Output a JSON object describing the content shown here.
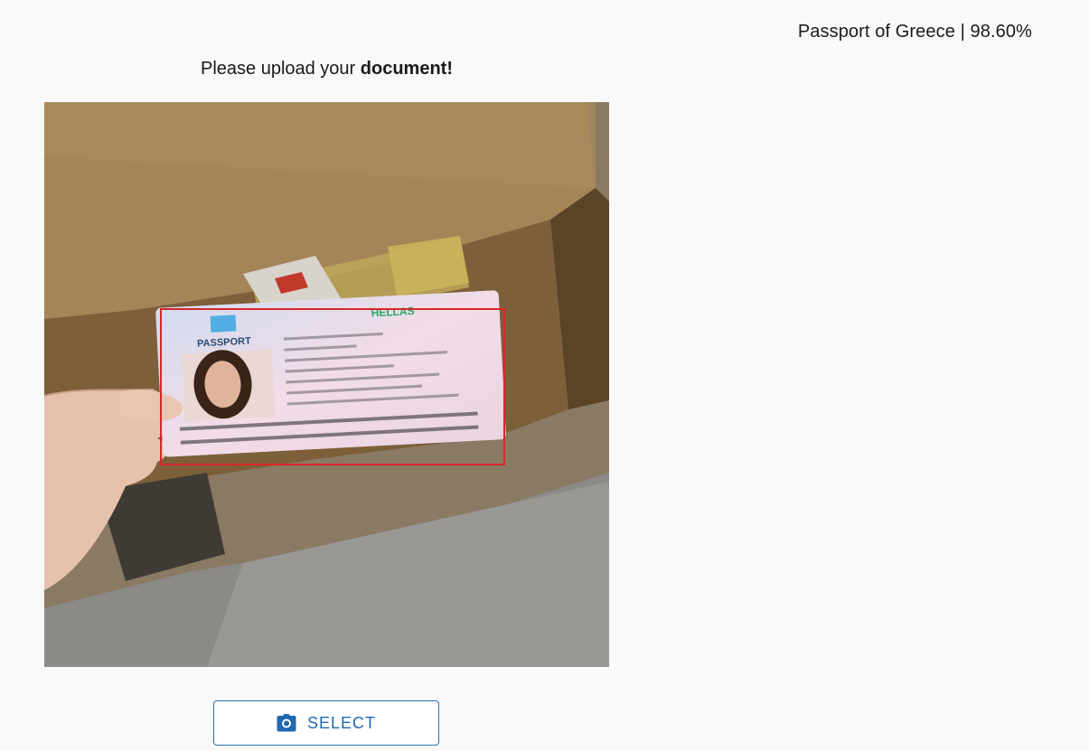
{
  "result": {
    "text": "Passport of Greece | 98.60%"
  },
  "prompt": {
    "lead": "Please upload your ",
    "emphasis": "document!"
  },
  "photo": {
    "passport_label": "PASSPORT",
    "country_label": "HELLAS"
  },
  "select_button": {
    "icon": "camera-icon",
    "label": "SELECT"
  },
  "colors": {
    "accent": "#1f68b2",
    "detection_box": "#d62828"
  }
}
